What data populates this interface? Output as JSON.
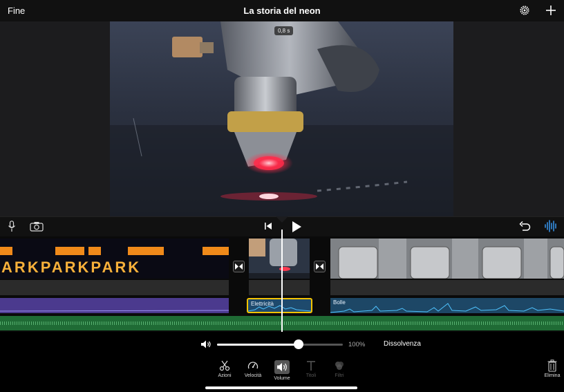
{
  "topbar": {
    "done_label": "Fine",
    "title": "La storia del neon"
  },
  "viewer": {
    "time_badge": "0,8 s"
  },
  "timeline": {
    "audio_clips": [
      "Elettricità",
      "Bolle"
    ],
    "clip1_text": "PARKPARKPARK"
  },
  "volume": {
    "percent_label": "100%",
    "level": 0.65,
    "fade_label": "Dissolvenza"
  },
  "toolbar": {
    "items": [
      {
        "label": "Azioni",
        "icon": "scissors-icon"
      },
      {
        "label": "Velocità",
        "icon": "speedometer-icon"
      },
      {
        "label": "Volume",
        "icon": "speaker-icon"
      },
      {
        "label": "Titoli",
        "icon": "text-icon"
      },
      {
        "label": "Filtri",
        "icon": "filters-icon"
      }
    ],
    "delete_label": "Elimina"
  },
  "colors": {
    "selection": "#f5c400",
    "audio_purple": "#4b3a8e",
    "audio_blue": "#1d4766",
    "music_green": "#1f6b35"
  }
}
